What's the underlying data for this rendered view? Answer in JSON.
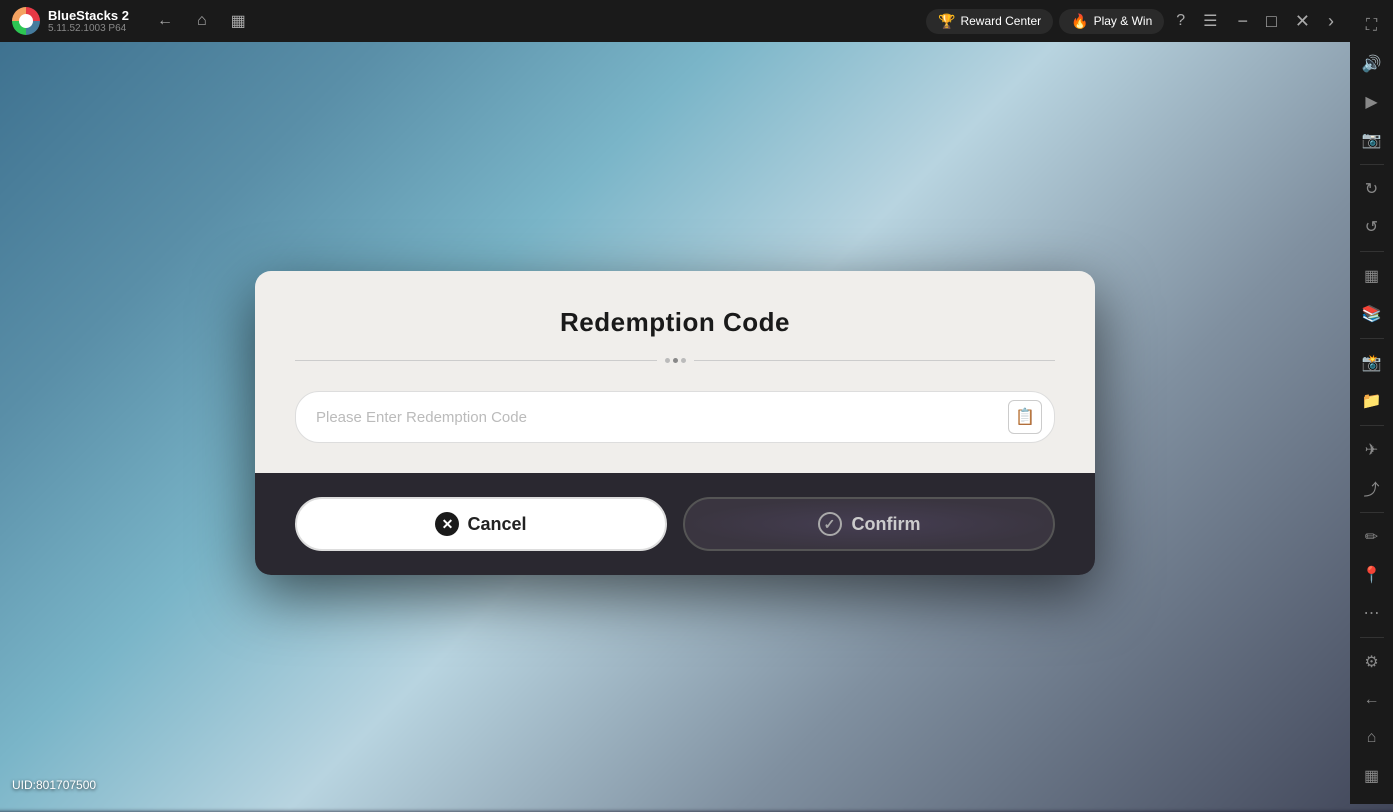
{
  "app": {
    "name": "BlueStacks 2",
    "version": "5.11.52.1003  P64"
  },
  "topbar": {
    "nav_back": "‹",
    "nav_home": "⌂",
    "nav_pages": "⧉",
    "reward_center_label": "Reward Center",
    "reward_center_icon": "🏆",
    "play_win_label": "Play & Win",
    "play_win_icon": "🔥"
  },
  "sidebar": {
    "icons": [
      {
        "name": "expand-icon",
        "symbol": "⛶"
      },
      {
        "name": "volume-icon",
        "symbol": "🔊"
      },
      {
        "name": "video-icon",
        "symbol": "▶"
      },
      {
        "name": "screenshot-icon",
        "symbol": "📷"
      },
      {
        "name": "rotate-icon",
        "symbol": "↻"
      },
      {
        "name": "rotate2-icon",
        "symbol": "↺"
      },
      {
        "name": "layers-icon",
        "symbol": "⊞"
      },
      {
        "name": "book-icon",
        "symbol": "📖"
      },
      {
        "name": "camera-icon",
        "symbol": "📸"
      },
      {
        "name": "folder-icon",
        "symbol": "📁"
      },
      {
        "name": "airplane-icon",
        "symbol": "✈"
      },
      {
        "name": "resize-icon",
        "symbol": "⤢"
      },
      {
        "name": "edit-icon",
        "symbol": "✏"
      },
      {
        "name": "location-icon",
        "symbol": "📍"
      },
      {
        "name": "more-icon",
        "symbol": "•••"
      },
      {
        "name": "settings-icon",
        "symbol": "⚙"
      },
      {
        "name": "back-icon",
        "symbol": "←"
      },
      {
        "name": "home-icon",
        "symbol": "⌂"
      },
      {
        "name": "pages-icon",
        "symbol": "⧉"
      }
    ]
  },
  "dialog": {
    "title": "Redemption Code",
    "input_placeholder": "Please Enter Redemption Code",
    "cancel_label": "Cancel",
    "confirm_label": "Confirm"
  },
  "footer": {
    "uid": "UID:801707500"
  }
}
